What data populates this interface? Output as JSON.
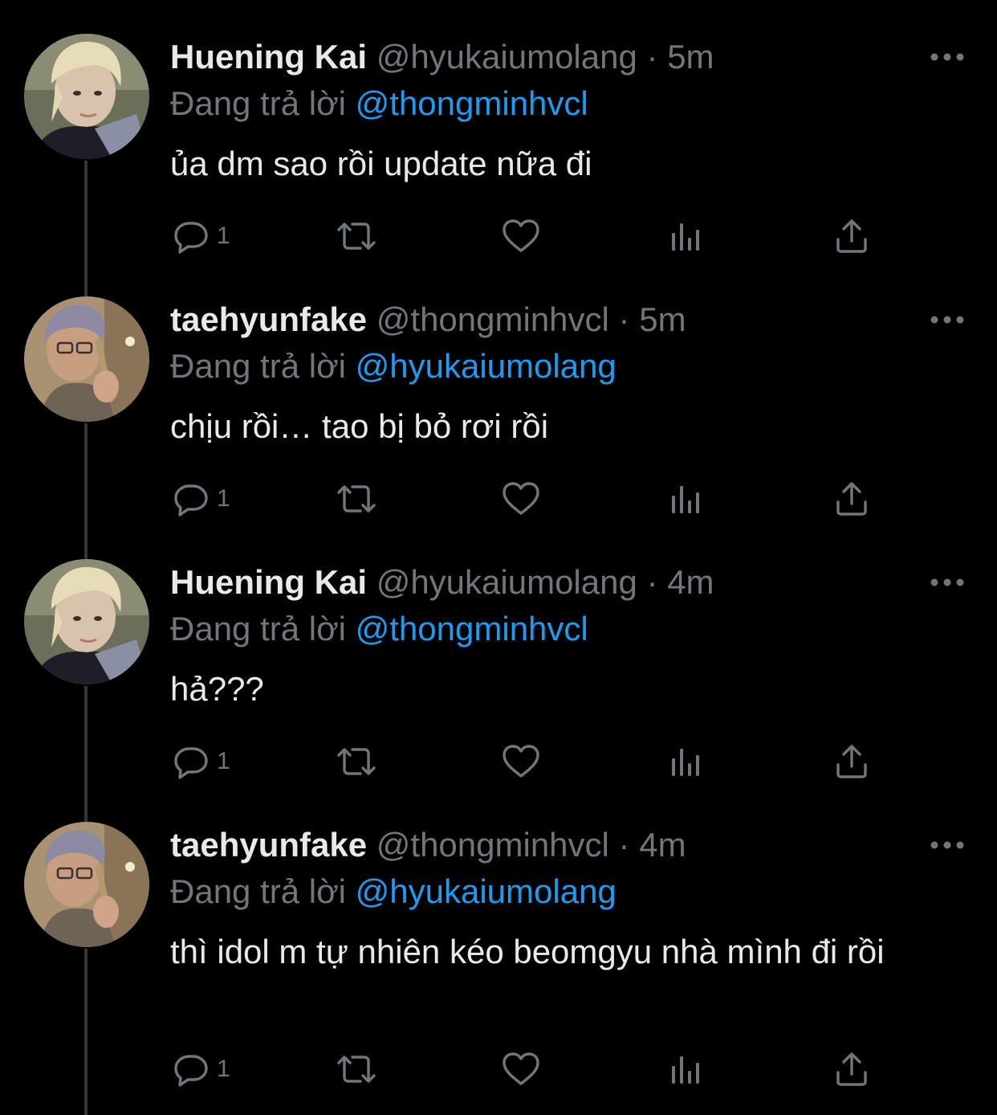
{
  "colors": {
    "background": "#000000",
    "primary_text": "#e7e9ea",
    "secondary_text": "#71767b",
    "mention": "#1d9bf0",
    "thread_line": "#333639"
  },
  "icons": {
    "more": "more-horizontal-icon",
    "reply": "speech-bubble-icon",
    "retweet": "retweet-arrows-icon",
    "like": "heart-outline-icon",
    "views": "bar-chart-icon",
    "share": "share-upload-icon"
  },
  "tweets": [
    {
      "name": "Huening Kai",
      "handle": "@hyukaiumolang",
      "separator": "·",
      "time": "5m",
      "reply_prefix": "Đang trả lời",
      "reply_to": "@thongminhvcl",
      "text": "ủa dm sao rồi update nữa đi",
      "reply_count": "1",
      "avatar_style": "blonde"
    },
    {
      "name": "taehyunfake",
      "handle": "@thongminhvcl",
      "separator": "·",
      "time": "5m",
      "reply_prefix": "Đang trả lời",
      "reply_to": "@hyukaiumolang",
      "text": "chịu rồi… tao bị bỏ rơi rồi",
      "reply_count": "1",
      "avatar_style": "grey-hair"
    },
    {
      "name": "Huening Kai",
      "handle": "@hyukaiumolang",
      "separator": "·",
      "time": "4m",
      "reply_prefix": "Đang trả lời",
      "reply_to": "@thongminhvcl",
      "text": "hả???",
      "reply_count": "1",
      "avatar_style": "blonde"
    },
    {
      "name": "taehyunfake",
      "handle": "@thongminhvcl",
      "separator": "·",
      "time": "4m",
      "reply_prefix": "Đang trả lời",
      "reply_to": "@hyukaiumolang",
      "text": "thì idol m tự nhiên kéo beomgyu nhà mình đi rồi",
      "reply_count": "1",
      "avatar_style": "grey-hair"
    }
  ]
}
